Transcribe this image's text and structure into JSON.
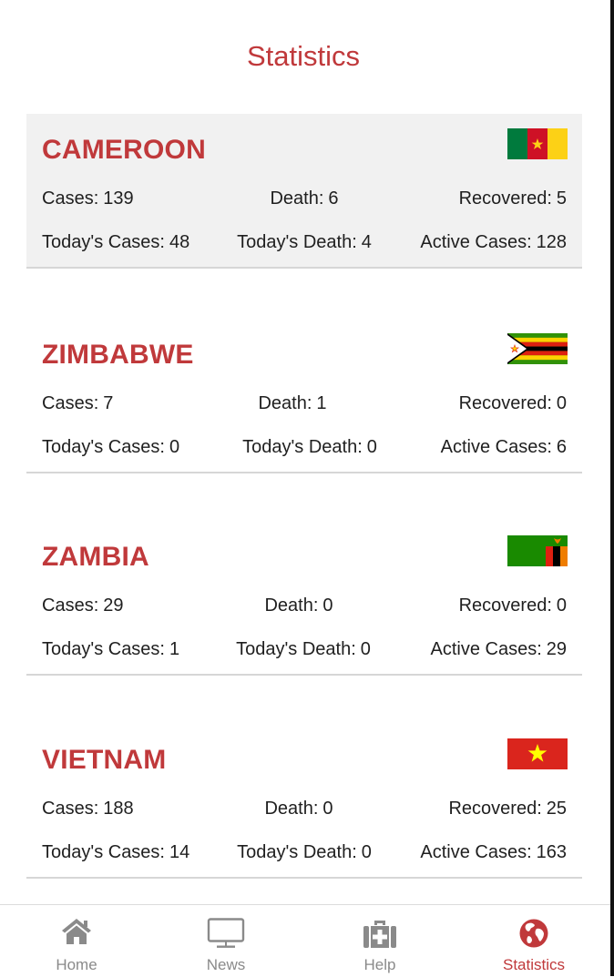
{
  "page": {
    "title": "Statistics"
  },
  "countries": [
    {
      "name": "CAMEROON",
      "flag": "cameroon-flag",
      "cases_label": "Cases:",
      "cases": "139",
      "death_label": "Death:",
      "death": "6",
      "recovered_label": "Recovered:",
      "recovered": "5",
      "today_cases_label": "Today's Cases:",
      "today_cases": "48",
      "today_death_label": "Today's Death:",
      "today_death": "4",
      "active_label": "Active Cases:",
      "active": "128"
    },
    {
      "name": "ZIMBABWE",
      "flag": "zimbabwe-flag",
      "cases_label": "Cases:",
      "cases": "7",
      "death_label": "Death:",
      "death": "1",
      "recovered_label": "Recovered:",
      "recovered": "0",
      "today_cases_label": "Today's Cases:",
      "today_cases": "0",
      "today_death_label": "Today's Death:",
      "today_death": "0",
      "active_label": "Active Cases:",
      "active": "6"
    },
    {
      "name": "ZAMBIA",
      "flag": "zambia-flag",
      "cases_label": "Cases:",
      "cases": "29",
      "death_label": "Death:",
      "death": "0",
      "recovered_label": "Recovered:",
      "recovered": "0",
      "today_cases_label": "Today's Cases:",
      "today_cases": "1",
      "today_death_label": "Today's Death:",
      "today_death": "0",
      "active_label": "Active Cases:",
      "active": "29"
    },
    {
      "name": "VIETNAM",
      "flag": "vietnam-flag",
      "cases_label": "Cases:",
      "cases": "188",
      "death_label": "Death:",
      "death": "0",
      "recovered_label": "Recovered:",
      "recovered": "25",
      "today_cases_label": "Today's Cases:",
      "today_cases": "14",
      "today_death_label": "Today's Death:",
      "today_death": "0",
      "active_label": "Active Cases:",
      "active": "163"
    }
  ],
  "nav": {
    "items": [
      {
        "label": "Home",
        "icon": "home-icon"
      },
      {
        "label": "News",
        "icon": "monitor-icon"
      },
      {
        "label": "Help",
        "icon": "first-aid-kit-icon"
      },
      {
        "label": "Statistics",
        "icon": "globe-icon",
        "active": true
      }
    ]
  },
  "colors": {
    "accent": "#c0393b",
    "nav_inactive": "#8a8a8a",
    "card_highlight": "#f1f1f1"
  }
}
